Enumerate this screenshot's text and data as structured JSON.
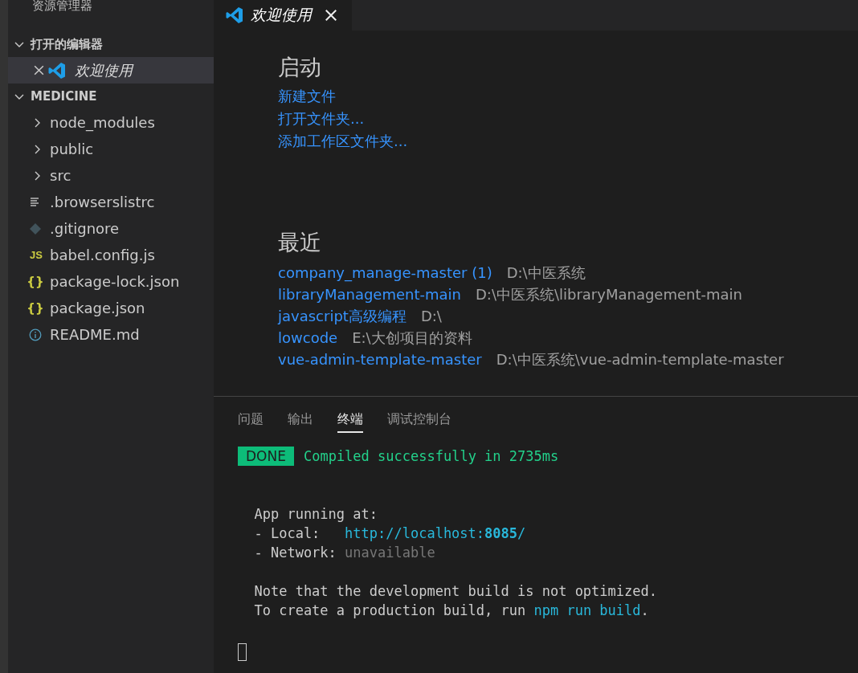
{
  "sidebar": {
    "title": "资源管理器",
    "open_editors": {
      "label": "打开的编辑器",
      "expanded": true,
      "items": [
        {
          "label": "欢迎使用",
          "selected": true
        }
      ]
    },
    "folder": {
      "label": "MEDICINE",
      "expanded": true,
      "items": [
        {
          "label": "node_modules",
          "kind": "folder",
          "expanded": false
        },
        {
          "label": "public",
          "kind": "folder",
          "expanded": false
        },
        {
          "label": "src",
          "kind": "folder",
          "expanded": false
        },
        {
          "label": ".browserslistrc",
          "kind": "text-file"
        },
        {
          "label": ".gitignore",
          "kind": "git-file"
        },
        {
          "label": "babel.config.js",
          "kind": "js-file",
          "icon_text": "JS"
        },
        {
          "label": "package-lock.json",
          "kind": "json-file",
          "icon_text": "{}"
        },
        {
          "label": "package.json",
          "kind": "json-file",
          "icon_text": "{}"
        },
        {
          "label": "README.md",
          "kind": "info-file"
        }
      ]
    }
  },
  "tabs": [
    {
      "label": "欢迎使用",
      "selected": true
    }
  ],
  "welcome": {
    "start": {
      "heading": "启动",
      "links": [
        "新建文件",
        "打开文件夹...",
        "添加工作区文件夹..."
      ]
    },
    "recent": {
      "heading": "最近",
      "items": [
        {
          "name": "company_manage-master (1)",
          "path": "D:\\中医系统"
        },
        {
          "name": "libraryManagement-main",
          "path": "D:\\中医系统\\libraryManagement-main"
        },
        {
          "name": "javascript高级编程",
          "path": "D:\\"
        },
        {
          "name": "lowcode",
          "path": "E:\\大创项目的资料"
        },
        {
          "name": "vue-admin-template-master",
          "path": "D:\\中医系统\\vue-admin-template-master"
        }
      ]
    }
  },
  "panel": {
    "tabs": [
      {
        "label": "问题",
        "selected": false
      },
      {
        "label": "输出",
        "selected": false
      },
      {
        "label": "终端",
        "selected": true
      },
      {
        "label": "调试控制台",
        "selected": false
      }
    ],
    "terminal": [
      {
        "kind": "text",
        "segments": [
          {
            "kind": "badge",
            "text": "DONE"
          },
          {
            "kind": "success",
            "text": "Compiled successfully in 2735ms"
          }
        ]
      },
      {
        "kind": "blank"
      },
      {
        "kind": "blank"
      },
      {
        "kind": "text",
        "segments": [
          {
            "kind": "plain",
            "text": "  App running at:"
          }
        ]
      },
      {
        "kind": "text",
        "segments": [
          {
            "kind": "plain",
            "text": "  - Local:   "
          },
          {
            "kind": "link",
            "text": "http://localhost:**8085**/"
          }
        ]
      },
      {
        "kind": "text",
        "segments": [
          {
            "kind": "plain",
            "text": "  - Network: "
          },
          {
            "kind": "muted",
            "text": "unavailable"
          }
        ]
      },
      {
        "kind": "blank"
      },
      {
        "kind": "text",
        "segments": [
          {
            "kind": "plain",
            "text": "  Note that the development build is not optimized."
          }
        ]
      },
      {
        "kind": "text",
        "segments": [
          {
            "kind": "plain",
            "text": "  To create a production build, run "
          },
          {
            "kind": "command",
            "text": "npm run build"
          },
          {
            "kind": "plain",
            "text": "."
          }
        ]
      },
      {
        "kind": "blank"
      },
      {
        "kind": "cursor"
      }
    ]
  }
}
